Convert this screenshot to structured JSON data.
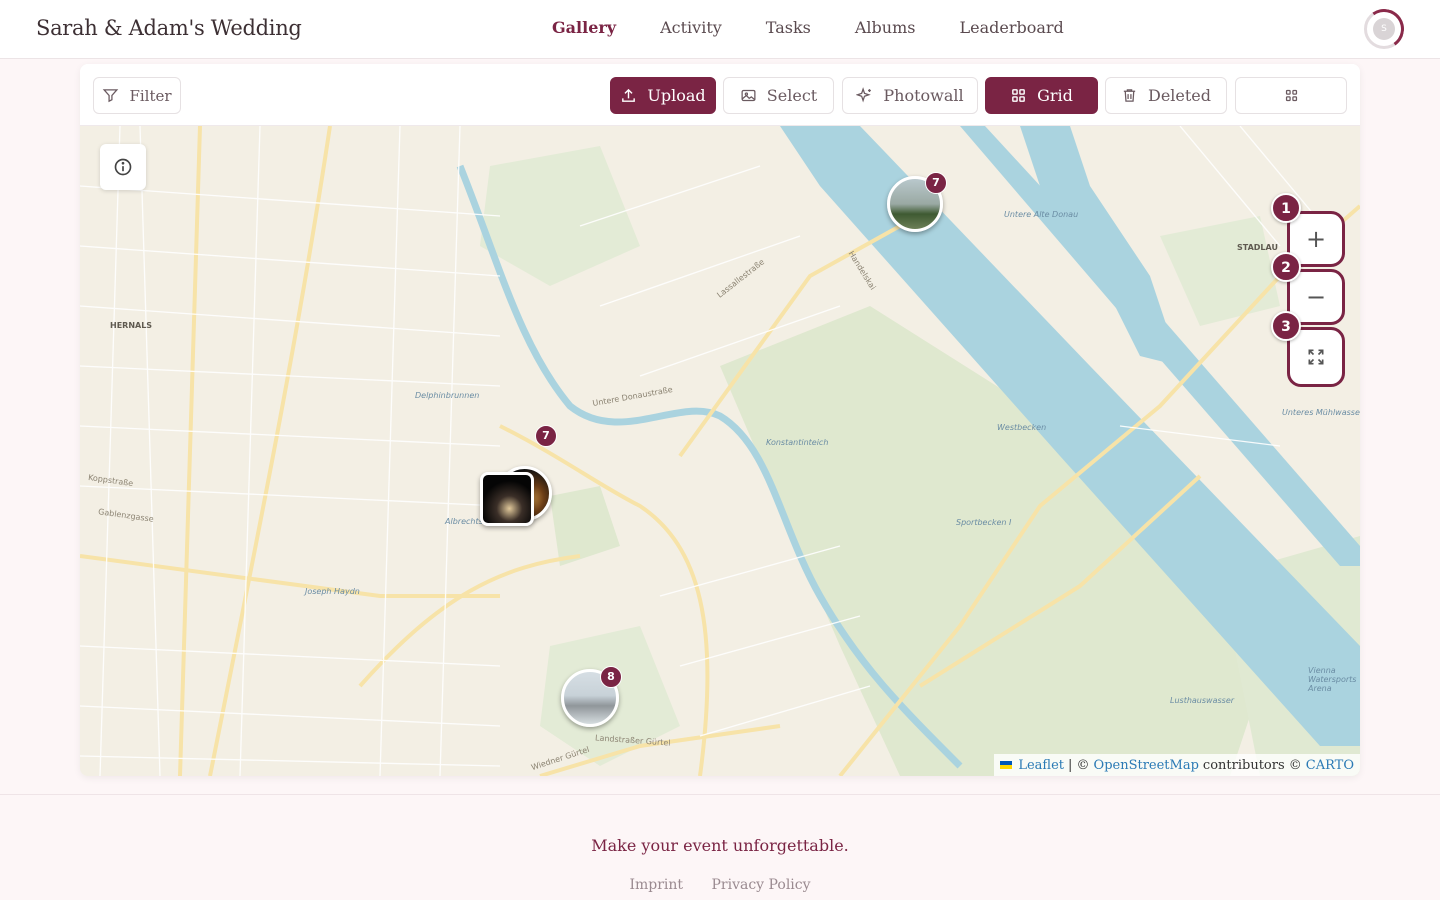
{
  "header": {
    "brand": "Sarah & Adam's Wedding",
    "nav": [
      "Gallery",
      "Activity",
      "Tasks",
      "Albums",
      "Leaderboard"
    ],
    "active": "Gallery",
    "avatar_initial": "S"
  },
  "toolbar": {
    "filter": "Filter",
    "upload": "Upload",
    "select": "Select",
    "photowall": "Photowall",
    "grid": "Grid",
    "deleted": "Deleted"
  },
  "map": {
    "zoom_badges": [
      "1",
      "2",
      "3"
    ],
    "zoom_in": "+",
    "zoom_out": "−",
    "clusters": [
      {
        "count": "7"
      },
      {
        "count": "7"
      },
      {
        "count": "8"
      }
    ],
    "labels": {
      "hernals": "HERNALS",
      "stadlau": "STADLAU",
      "delphinbrunnen": "Delphinbrunnen",
      "albrechtsbrunnen": "Albrechtsbrunnen",
      "joseph_haydn": "Joseph Haydn",
      "konstantinteich": "Konstantinteich",
      "westbecken": "Westbecken",
      "sportbecken": "Sportbecken I",
      "koppstrasse": "Koppstraße",
      "gablenzgasse": "Gablenzgasse",
      "lassallestrasse": "Lassallestraße",
      "untere_donaustrasse": "Untere Donaustraße",
      "handelskai": "Handelskai",
      "unteres_muehlwasser": "Unteres Mühlwasser",
      "untere_alte_donau": "Untere Alte Donau",
      "lusthauswasser": "Lusthauswasser",
      "vienna_watersports": "Vienna Watersports Arena",
      "landstrasser_guertel": "Landstraßer Gürtel",
      "wiedner_guertel": "Wiedner Gürtel"
    },
    "attribution": {
      "leaflet": "Leaflet",
      "sep": "| ©",
      "osm": "OpenStreetMap",
      "contributors": "contributors ©",
      "carto": "CARTO"
    }
  },
  "footer": {
    "tagline": "Make your event unforgettable.",
    "imprint": "Imprint",
    "privacy": "Privacy Policy"
  },
  "colors": {
    "accent": "#7a2444",
    "map_land": "#f3efe4",
    "map_water": "#aad3df",
    "map_park": "#dfe8cf"
  }
}
